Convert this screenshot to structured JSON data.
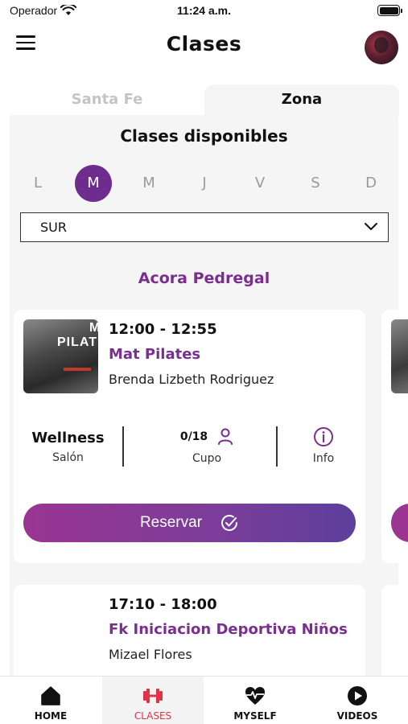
{
  "status_bar": {
    "carrier": "Operador",
    "time": "11:24 a.m."
  },
  "header": {
    "title": "Clases"
  },
  "location_tabs": [
    {
      "label": "Santa Fe",
      "selected": false
    },
    {
      "label": "Zona",
      "selected": true
    }
  ],
  "main": {
    "section_title": "Clases disponibles",
    "days": [
      {
        "label": "L",
        "selected": false
      },
      {
        "label": "M",
        "selected": true
      },
      {
        "label": "M",
        "selected": false
      },
      {
        "label": "J",
        "selected": false
      },
      {
        "label": "V",
        "selected": false
      },
      {
        "label": "S",
        "selected": false
      },
      {
        "label": "D",
        "selected": false
      }
    ],
    "zone_select": {
      "value": "SUR"
    },
    "venue": "Acora Pedregal"
  },
  "classes": [
    {
      "time": "12:00 - 12:55",
      "name": "Mat Pilates",
      "instructor": "Brenda Lizbeth Rodriguez",
      "image_text": "PILAT",
      "image_text2": "M",
      "salon_value": "Wellness",
      "salon_label": "Salón",
      "cupo_value": "0/18",
      "cupo_label": "Cupo",
      "info_label": "Info",
      "reserve_label": "Reservar"
    },
    {
      "time": "17:10 - 18:00",
      "name": "Fk Iniciacion Deportiva Niños",
      "instructor": "Mizael Flores"
    }
  ],
  "tab_bar": [
    {
      "label": "HOME",
      "icon": "home-icon",
      "active": false
    },
    {
      "label": "CLASES",
      "icon": "dumbbell-icon",
      "active": true
    },
    {
      "label": "MYSELF",
      "icon": "heart-pulse-icon",
      "active": false
    },
    {
      "label": "VIDEOS",
      "icon": "play-icon",
      "active": false
    }
  ],
  "colors": {
    "accent_purple": "#7a2e8f",
    "active_tab_red": "#e0334a",
    "button_gradient_start": "#9a3592",
    "button_gradient_end": "#5c3f9c"
  }
}
